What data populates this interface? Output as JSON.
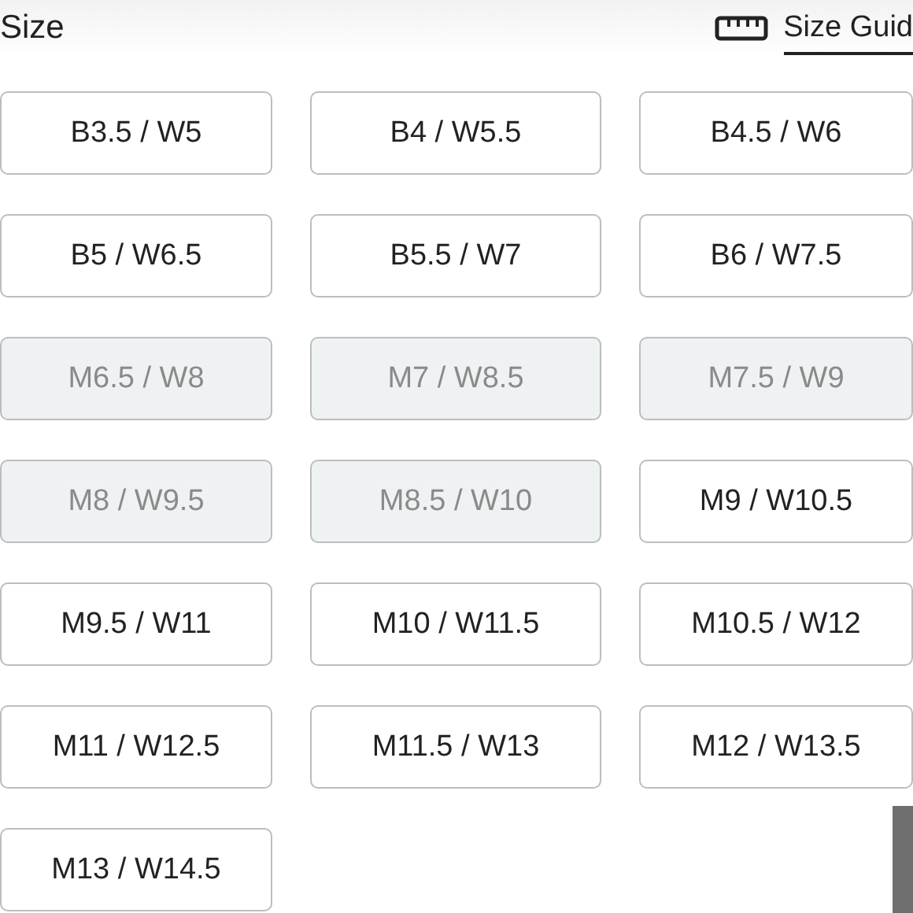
{
  "header": {
    "title": "Size",
    "size_guide": "Size Guid"
  },
  "sizes": [
    {
      "label": "B3.5 / W5",
      "disabled": false
    },
    {
      "label": "B4 / W5.5",
      "disabled": false
    },
    {
      "label": "B4.5 / W6",
      "disabled": false
    },
    {
      "label": "B5 / W6.5",
      "disabled": false
    },
    {
      "label": "B5.5 / W7",
      "disabled": false
    },
    {
      "label": "B6 / W7.5",
      "disabled": false
    },
    {
      "label": "M6.5 / W8",
      "disabled": true
    },
    {
      "label": "M7 / W8.5",
      "disabled": true
    },
    {
      "label": "M7.5 / W9",
      "disabled": true
    },
    {
      "label": "M8 / W9.5",
      "disabled": true
    },
    {
      "label": "M8.5 / W10",
      "disabled": true
    },
    {
      "label": "M9 / W10.5",
      "disabled": false
    },
    {
      "label": "M9.5 / W11",
      "disabled": false
    },
    {
      "label": "M10 / W11.5",
      "disabled": false
    },
    {
      "label": "M10.5 / W12",
      "disabled": false
    },
    {
      "label": "M11 / W12.5",
      "disabled": false
    },
    {
      "label": "M11.5 / W13",
      "disabled": false
    },
    {
      "label": "M12 / W13.5",
      "disabled": false
    },
    {
      "label": "M13 / W14.5",
      "disabled": false
    }
  ]
}
